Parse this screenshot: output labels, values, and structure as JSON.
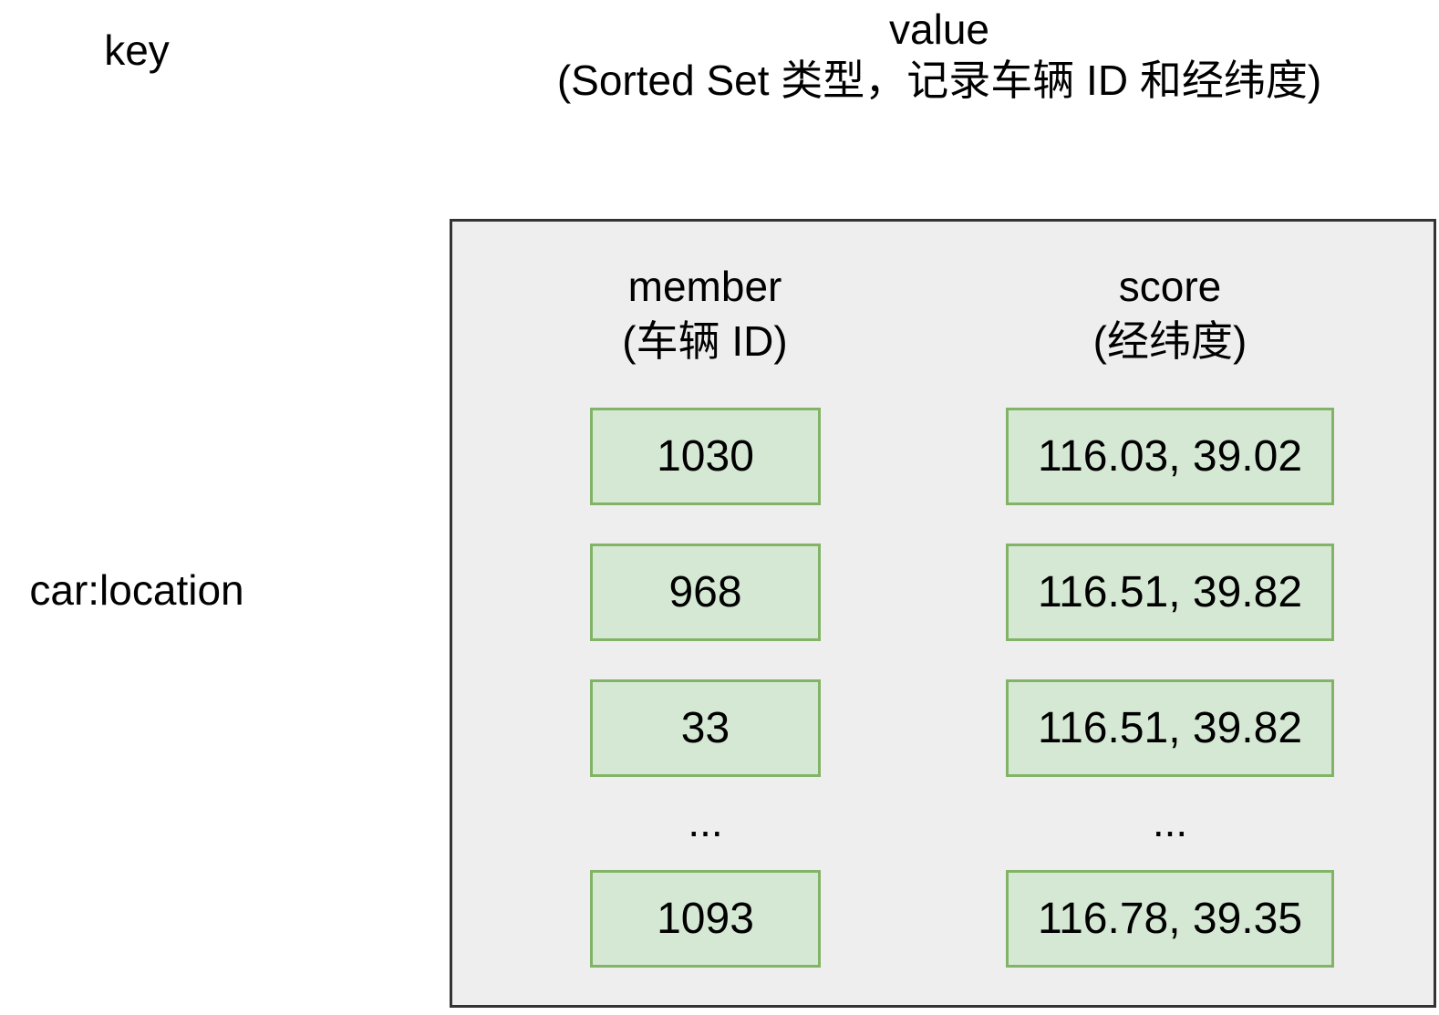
{
  "key_label": "key",
  "value_title": {
    "line1": "value",
    "line2": "(Sorted Set 类型，记录车辆 ID 和经纬度)"
  },
  "key_name": "car:location",
  "member_header": {
    "line1": "member",
    "line2": "(车辆 ID)"
  },
  "score_header": {
    "line1": "score",
    "line2": "(经纬度)"
  },
  "rows": [
    {
      "member": "1030",
      "score": "116.03, 39.02"
    },
    {
      "member": "968",
      "score": "116.51, 39.82"
    },
    {
      "member": "33",
      "score": "116.51, 39.82"
    },
    {
      "member": "1093",
      "score": "116.78, 39.35"
    }
  ],
  "ellipsis": "...",
  "colors": {
    "container_fill": "#eeeeee",
    "container_border": "#333333",
    "cell_fill": "#d5e8d4",
    "cell_border": "#82b366"
  }
}
